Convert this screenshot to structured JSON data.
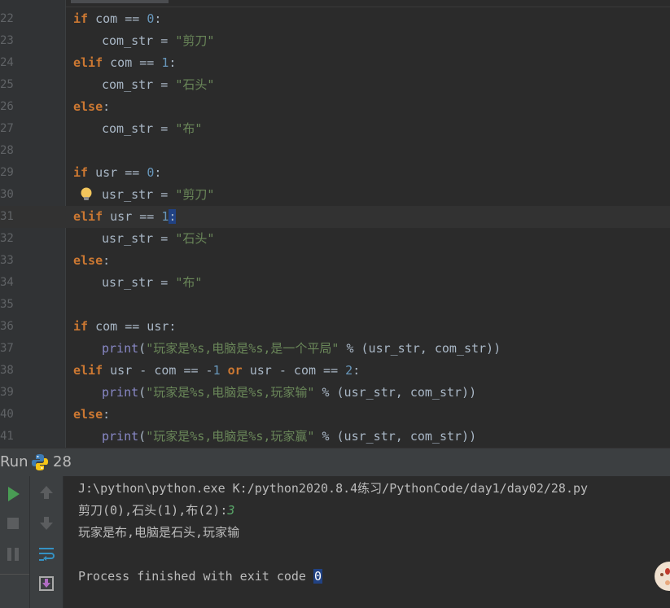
{
  "editor": {
    "lines": [
      {
        "n": "22",
        "parts": [
          {
            "t": "if",
            "c": "kw"
          },
          {
            "t": " com == ",
            "c": ""
          },
          {
            "t": "0",
            "c": "num"
          },
          {
            "t": ":",
            "c": ""
          }
        ],
        "indent": 0
      },
      {
        "n": "23",
        "parts": [
          {
            "t": "com_str = ",
            "c": ""
          },
          {
            "t": "\"剪刀\"",
            "c": "str"
          }
        ],
        "indent": 1
      },
      {
        "n": "24",
        "parts": [
          {
            "t": "elif",
            "c": "kw"
          },
          {
            "t": " com == ",
            "c": ""
          },
          {
            "t": "1",
            "c": "num"
          },
          {
            "t": ":",
            "c": ""
          }
        ],
        "indent": 0
      },
      {
        "n": "25",
        "parts": [
          {
            "t": "com_str = ",
            "c": ""
          },
          {
            "t": "\"石头\"",
            "c": "str"
          }
        ],
        "indent": 1
      },
      {
        "n": "26",
        "parts": [
          {
            "t": "else",
            "c": "kw"
          },
          {
            "t": ":",
            "c": ""
          }
        ],
        "indent": 0
      },
      {
        "n": "27",
        "parts": [
          {
            "t": "com_str = ",
            "c": ""
          },
          {
            "t": "\"布\"",
            "c": "str"
          }
        ],
        "indent": 1
      },
      {
        "n": "28",
        "parts": [],
        "indent": 0
      },
      {
        "n": "29",
        "parts": [
          {
            "t": "if",
            "c": "kw"
          },
          {
            "t": " usr == ",
            "c": ""
          },
          {
            "t": "0",
            "c": "num"
          },
          {
            "t": ":",
            "c": ""
          }
        ],
        "indent": 0
      },
      {
        "n": "30",
        "parts": [
          {
            "t": "usr_str = ",
            "c": ""
          },
          {
            "t": "\"剪刀\"",
            "c": "str"
          }
        ],
        "indent": 1,
        "bulb": true
      },
      {
        "n": "31",
        "parts": [
          {
            "t": "elif",
            "c": "kw"
          },
          {
            "t": " usr == ",
            "c": ""
          },
          {
            "t": "1",
            "c": "num"
          },
          {
            "t": ":",
            "c": "hl"
          }
        ],
        "indent": 0,
        "current": true
      },
      {
        "n": "32",
        "parts": [
          {
            "t": "usr_str = ",
            "c": ""
          },
          {
            "t": "\"石头\"",
            "c": "str"
          }
        ],
        "indent": 1
      },
      {
        "n": "33",
        "parts": [
          {
            "t": "else",
            "c": "kw"
          },
          {
            "t": ":",
            "c": ""
          }
        ],
        "indent": 0
      },
      {
        "n": "34",
        "parts": [
          {
            "t": "usr_str = ",
            "c": ""
          },
          {
            "t": "\"布\"",
            "c": "str"
          }
        ],
        "indent": 1
      },
      {
        "n": "35",
        "parts": [],
        "indent": 0
      },
      {
        "n": "36",
        "parts": [
          {
            "t": "if",
            "c": "kw"
          },
          {
            "t": " com == usr:",
            "c": ""
          }
        ],
        "indent": 0
      },
      {
        "n": "37",
        "parts": [
          {
            "t": "print",
            "c": "fn"
          },
          {
            "t": "(",
            "c": ""
          },
          {
            "t": "\"玩家是%s,电脑是%s,是一个平局\"",
            "c": "str"
          },
          {
            "t": " % (usr_str, com_str))",
            "c": ""
          }
        ],
        "indent": 1
      },
      {
        "n": "38",
        "parts": [
          {
            "t": "elif",
            "c": "kw"
          },
          {
            "t": " usr - com == -",
            "c": ""
          },
          {
            "t": "1",
            "c": "num"
          },
          {
            "t": " ",
            "c": ""
          },
          {
            "t": "or",
            "c": "kw"
          },
          {
            "t": " usr - com == ",
            "c": ""
          },
          {
            "t": "2",
            "c": "num"
          },
          {
            "t": ":",
            "c": ""
          }
        ],
        "indent": 0
      },
      {
        "n": "39",
        "parts": [
          {
            "t": "print",
            "c": "fn"
          },
          {
            "t": "(",
            "c": ""
          },
          {
            "t": "\"玩家是%s,电脑是%s,玩家输\"",
            "c": "str"
          },
          {
            "t": " % (usr_str, com_str))",
            "c": ""
          }
        ],
        "indent": 1
      },
      {
        "n": "40",
        "parts": [
          {
            "t": "else",
            "c": "kw"
          },
          {
            "t": ":",
            "c": ""
          }
        ],
        "indent": 0
      },
      {
        "n": "41",
        "parts": [
          {
            "t": "print",
            "c": "fn"
          },
          {
            "t": "(",
            "c": ""
          },
          {
            "t": "\"玩家是%s,电脑是%s,玩家赢\"",
            "c": "str"
          },
          {
            "t": " % (usr_str, com_str))",
            "c": ""
          }
        ],
        "indent": 1
      }
    ]
  },
  "run": {
    "label": "Run",
    "config_name": "28",
    "icons": [
      "run-icon",
      "stop-icon",
      "pause-icon",
      "up-arrow-icon",
      "down-arrow-icon",
      "soft-wrap-icon",
      "print-icon"
    ]
  },
  "console": {
    "command": "J:\\python\\python.exe K:/python2020.8.4练习/PythonCode/day1/day02/28.py",
    "prompt": "剪刀(0),石头(1),布(2):",
    "input_value": "3",
    "result": "玩家是布,电脑是石头,玩家输",
    "finish_text": "Process finished with exit code ",
    "exit_code": "0"
  },
  "colors": {
    "keyword": "#cc7832",
    "number": "#6897bb",
    "string": "#6a8759",
    "builtin": "#8888c6",
    "run_green": "#499c54"
  }
}
